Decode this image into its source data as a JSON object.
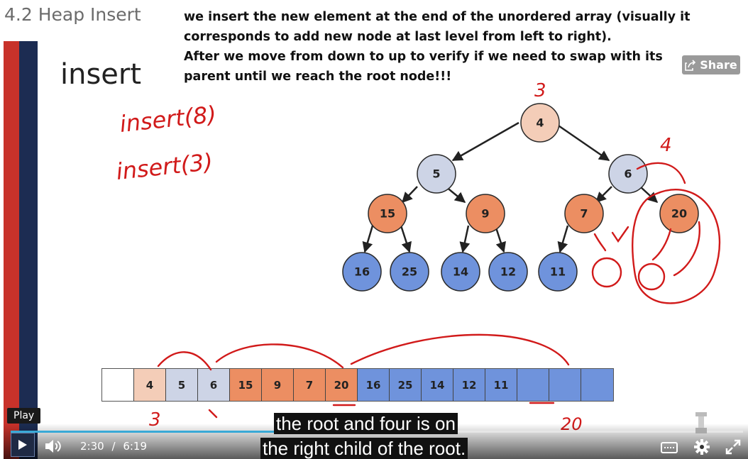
{
  "page": {
    "heading": "4.2 Heap Insert",
    "notes": [
      "we insert the new element at the end of the unordered array (visually it",
      "corresponds to add new node at last level from left to right).",
      "After we move from down to up to verify if we need to swap with its",
      "parent until we reach the root node!!!"
    ]
  },
  "slide": {
    "title": "insert",
    "share_label": "Share",
    "tree_nodes": [
      {
        "value": "4",
        "color": "#f4cdb8"
      },
      {
        "value": "5",
        "color": "#cdd4e6"
      },
      {
        "value": "6",
        "color": "#cdd4e6"
      },
      {
        "value": "15",
        "color": "#ec8e62"
      },
      {
        "value": "9",
        "color": "#ec8e62"
      },
      {
        "value": "7",
        "color": "#ec8e62"
      },
      {
        "value": "20",
        "color": "#ec8e62"
      },
      {
        "value": "16",
        "color": "#6f93dc"
      },
      {
        "value": "25",
        "color": "#6f93dc"
      },
      {
        "value": "14",
        "color": "#6f93dc"
      },
      {
        "value": "12",
        "color": "#6f93dc"
      },
      {
        "value": "11",
        "color": "#6f93dc"
      }
    ],
    "array_cells": [
      {
        "value": "",
        "color": "#ffffff"
      },
      {
        "value": "4",
        "color": "#f4cdb8"
      },
      {
        "value": "5",
        "color": "#cdd4e6"
      },
      {
        "value": "6",
        "color": "#cdd4e6"
      },
      {
        "value": "15",
        "color": "#ec8e62"
      },
      {
        "value": "9",
        "color": "#ec8e62"
      },
      {
        "value": "7",
        "color": "#ec8e62"
      },
      {
        "value": "20",
        "color": "#ec8e62"
      },
      {
        "value": "16",
        "color": "#6f93dc"
      },
      {
        "value": "25",
        "color": "#6f93dc"
      },
      {
        "value": "14",
        "color": "#6f93dc"
      },
      {
        "value": "12",
        "color": "#6f93dc"
      },
      {
        "value": "11",
        "color": "#6f93dc"
      },
      {
        "value": "",
        "color": "#6f93dc"
      },
      {
        "value": "",
        "color": "#6f93dc"
      },
      {
        "value": "",
        "color": "#6f93dc"
      }
    ],
    "handwriting": {
      "insert_8": "insert(8)",
      "insert_3": "insert(3)",
      "root_mark": "3",
      "right_mark": "4",
      "below_array_3": "3",
      "below_array_20": "20",
      "ink_color": "#d11a1a"
    }
  },
  "player": {
    "play_tooltip": "Play",
    "current_time": "2:30",
    "time_separator": "/",
    "duration": "6:19",
    "progress_fraction": 0.395,
    "caption_line1": "the root and four is on",
    "caption_line2": "the right child of the root."
  }
}
